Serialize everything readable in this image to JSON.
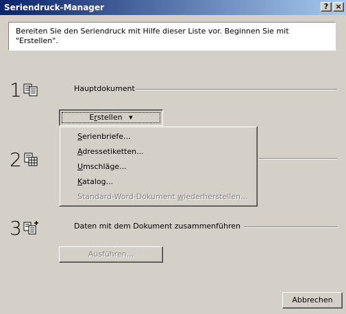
{
  "window": {
    "title": "Seriendruck-Manager",
    "help_label": "?",
    "close_label": "×"
  },
  "intro": {
    "line1": "Bereiten Sie den Seriendruck mit Hilfe dieser Liste vor. Beginnen Sie mit",
    "line2": "\"Erstellen\"."
  },
  "steps": [
    {
      "number": "1",
      "label": "Hauptdokument",
      "icon": "document-list-icon"
    },
    {
      "number": "2",
      "label": "",
      "icon": "data-table-icon"
    },
    {
      "number": "3",
      "label": "Daten mit dem Dokument zusammenführen",
      "icon": "merge-document-icon"
    }
  ],
  "create_button": {
    "pre": "E",
    "accel": "r",
    "post": "stellen",
    "arrow": "▾"
  },
  "menu": {
    "items": [
      {
        "accel": "S",
        "rest": "erienbriefe..."
      },
      {
        "accel": "A",
        "rest": "dressetiketten..."
      },
      {
        "accel": "U",
        "rest": "mschläge..."
      },
      {
        "accel": "K",
        "rest": "atalog..."
      }
    ],
    "restore": {
      "pre": "Standard-Word-Dokument ",
      "accel": "w",
      "post": "iederherstellen..."
    }
  },
  "execute_button": {
    "label": "Ausführen..."
  },
  "cancel_button": {
    "label": "Abbrechen"
  }
}
